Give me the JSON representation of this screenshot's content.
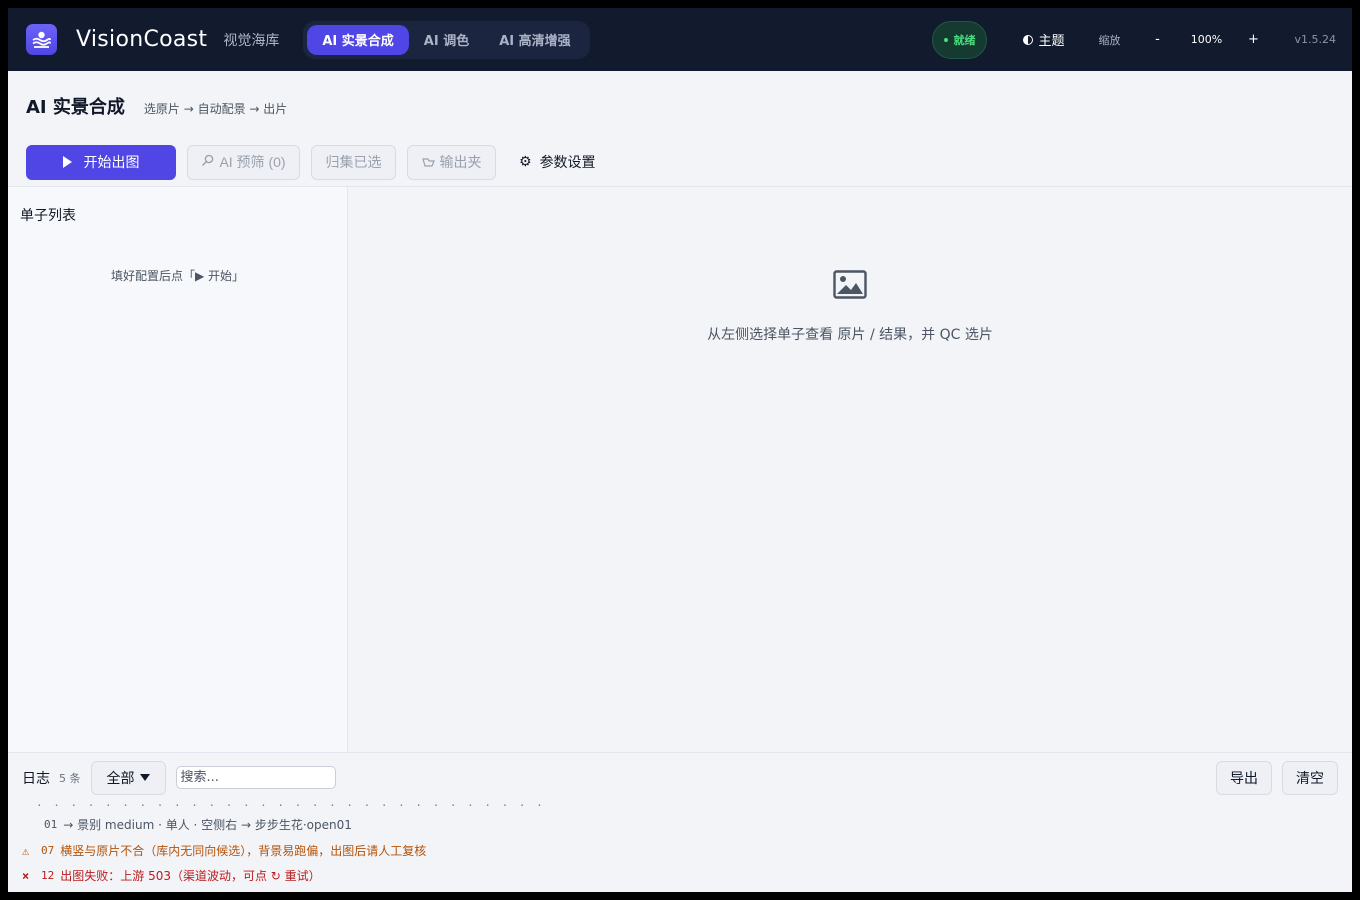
{
  "app": {
    "brand": "VisionCoast",
    "brand_sub": "视觉海库",
    "tabs": [
      {
        "label": "AI 实景合成",
        "active": true
      },
      {
        "label": "AI 调色",
        "active": false
      },
      {
        "label": "AI 高清增强",
        "active": false
      }
    ],
    "status": "就绪",
    "theme_label": "主题",
    "zoom_label": "缩放",
    "zoom_minus": "-",
    "zoom_value": "100%",
    "zoom_plus": "+",
    "version": "v1.5.24",
    "colors": {
      "accent": "#4f46e5",
      "topbar": "#121a2e",
      "status_green": "#4ade80"
    }
  },
  "page": {
    "title": "AI 实景合成",
    "breadcrumb": "选原片 → 自动配景 → 出片"
  },
  "toolbar": {
    "start_label": "开始出图",
    "ai_filter_label": "AI 预筛 (0)",
    "collect_label": "归集已选",
    "output_label": "输出夹",
    "settings_label": "参数设置"
  },
  "sidebar": {
    "title": "单子列表",
    "hint": "填好配置后点「▶ 开始」"
  },
  "preview": {
    "empty_text": "从左侧选择单子查看 原片 / 结果，并 QC 选片"
  },
  "log": {
    "title": "日志",
    "count": "5 条",
    "filter_value": "全部",
    "search_placeholder": "搜索...",
    "export_label": "导出",
    "clear_label": "清空",
    "lines": [
      {
        "level": "info",
        "mark": "",
        "id": "01",
        "text": "→ 景别 medium · 单人 · 空侧右 → 步步生花·open01"
      },
      {
        "level": "warn",
        "mark": "⚠",
        "id": "07",
        "text": "横竖与原片不合（库内无同向候选），背景易跑偏，出图后请人工复核"
      },
      {
        "level": "error",
        "mark": "×",
        "id": "12",
        "text": "出图失败：上游 503（渠道波动，可点 ↻ 重试）"
      }
    ]
  }
}
